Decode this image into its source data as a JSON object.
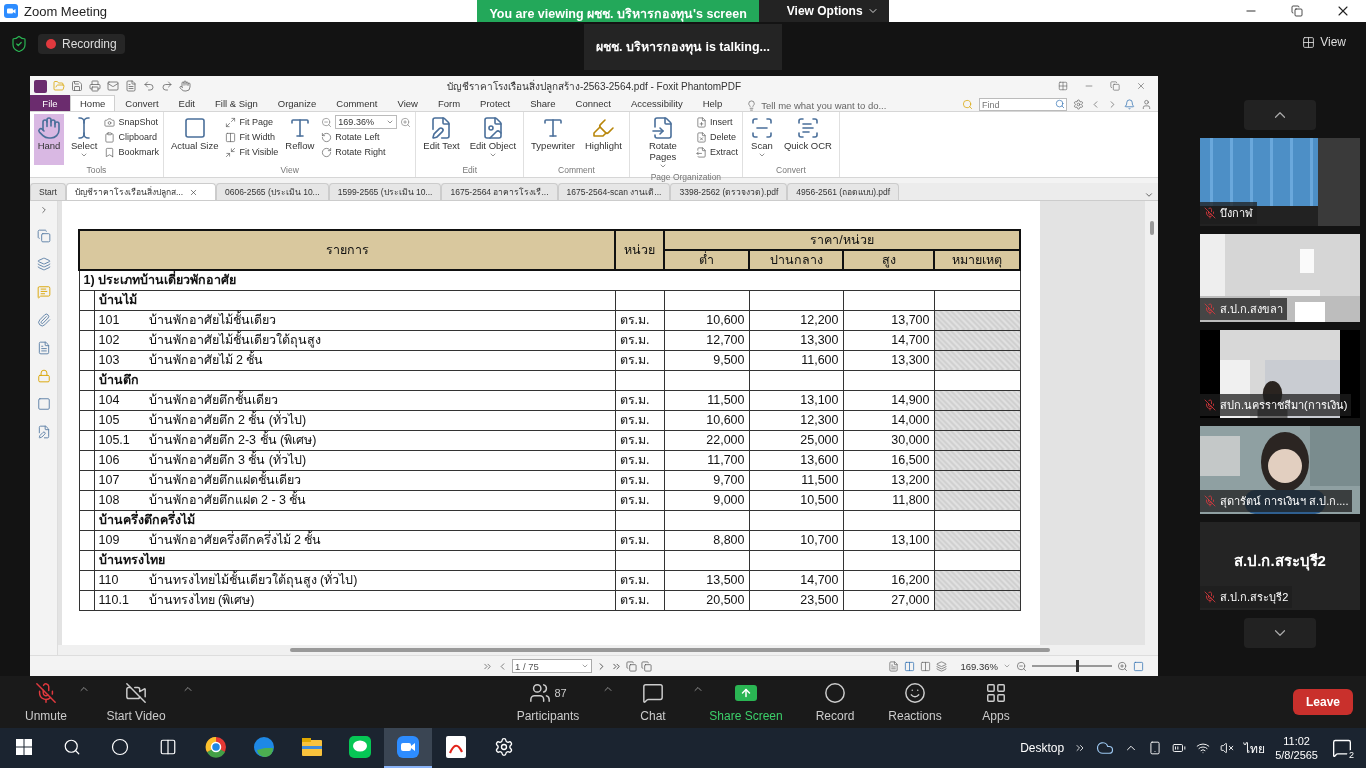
{
  "zoom": {
    "title": "Zoom Meeting",
    "banner": {
      "text": "You are viewing ผชช. บริหารกองทุน's screen",
      "options": "View Options"
    },
    "recording": "Recording",
    "talking": "ผชช. บริหารกองทุน is talking...",
    "view": "View"
  },
  "pdf": {
    "title": "บัญชีราคาโรงเรือนสิ่งปลูกสร้าง-2563-2564.pdf - Foxit PhantomPDF",
    "menu": [
      {
        "label": "File",
        "selected": false
      },
      {
        "label": "Home",
        "selected": true
      },
      {
        "label": "Convert",
        "selected": false
      },
      {
        "label": "Edit",
        "selected": false
      },
      {
        "label": "Fill & Sign",
        "selected": false
      },
      {
        "label": "Organize",
        "selected": false
      },
      {
        "label": "Comment",
        "selected": false
      },
      {
        "label": "View",
        "selected": false
      },
      {
        "label": "Form",
        "selected": false
      },
      {
        "label": "Protect",
        "selected": false
      },
      {
        "label": "Share",
        "selected": false
      },
      {
        "label": "Connect",
        "selected": false
      },
      {
        "label": "Accessibility",
        "selected": false
      },
      {
        "label": "Help",
        "selected": false
      }
    ],
    "tell_me": "Tell me what you want to do...",
    "find": {
      "placeholder": "Find"
    },
    "ribbon": [
      {
        "label": "Tools",
        "items": [
          {
            "kind": "large",
            "label": "Hand",
            "selected": true,
            "dropdown": false
          },
          {
            "kind": "large",
            "label": "Select",
            "selected": false,
            "dropdown": true
          },
          {
            "kind": "stack",
            "entries": [
              "SnapShot",
              "Clipboard",
              "Bookmark"
            ]
          }
        ]
      },
      {
        "label": "View",
        "items": [
          {
            "kind": "large",
            "label": "Actual Size",
            "selected": false,
            "dropdown": false
          },
          {
            "kind": "stack",
            "entries": [
              "Fit Page",
              "Fit Width",
              "Fit Visible"
            ]
          },
          {
            "kind": "large",
            "label": "Reflow",
            "selected": false,
            "dropdown": false
          },
          {
            "kind": "zoom",
            "value": "169.36%",
            "entries": [
              "Rotate Left",
              "Rotate Right"
            ]
          }
        ]
      },
      {
        "label": "Edit",
        "items": [
          {
            "kind": "large",
            "label": "Edit Text",
            "selected": false,
            "dropdown": false
          },
          {
            "kind": "large",
            "label": "Edit Object",
            "selected": false,
            "dropdown": true
          }
        ]
      },
      {
        "label": "Comment",
        "items": [
          {
            "kind": "large",
            "label": "Typewriter",
            "selected": false,
            "dropdown": false
          },
          {
            "kind": "large",
            "label": "Highlight",
            "selected": false,
            "dropdown": false
          }
        ]
      },
      {
        "label": "Page Organization",
        "items": [
          {
            "kind": "large",
            "label": "Rotate Pages",
            "selected": false,
            "dropdown": true
          },
          {
            "kind": "stack",
            "entries": [
              "Insert",
              "Delete",
              "Extract"
            ]
          }
        ]
      },
      {
        "label": "Convert",
        "items": [
          {
            "kind": "large",
            "label": "Scan",
            "selected": false,
            "dropdown": true
          },
          {
            "kind": "large",
            "label": "Quick OCR",
            "selected": false,
            "dropdown": false
          }
        ]
      }
    ],
    "doc_tabs": [
      {
        "label": "Start",
        "selected": false
      },
      {
        "label": "บัญชีราคาโรงเรือนสิ่งปลูกส...",
        "selected": true
      },
      {
        "label": "0606-2565  (ประเมิน 10...",
        "selected": false
      },
      {
        "label": "1599-2565 (ประเมิน 10...",
        "selected": false
      },
      {
        "label": "1675-2564 อาคารโรงเรื...",
        "selected": false
      },
      {
        "label": "1675-2564-scan งานเติ...",
        "selected": false
      },
      {
        "label": "3398-2562 (ตรวจงวด).pdf",
        "selected": false
      },
      {
        "label": "4956-2561 (ถอดแบบ).pdf",
        "selected": false
      }
    ],
    "table": {
      "columns": {
        "item": "รายการ",
        "unit": "หน่วย",
        "price": "ราคา/หน่วย",
        "low": "ต่ำ",
        "mid": "ปานกลาง",
        "high": "สูง",
        "remark": "หมายเหตุ"
      },
      "section": {
        "number": "1)",
        "title": "ประเภทบ้านเดี่ยวพักอาศัย"
      },
      "groups": [
        {
          "title": "บ้านไม้",
          "rows": [
            {
              "code": "101",
              "name": "บ้านพักอาศัยไม้ชั้นเดียว",
              "unit": "ตร.ม.",
              "low": "10,600",
              "mid": "12,200",
              "high": "13,700"
            },
            {
              "code": "102",
              "name": "บ้านพักอาศัยไม้ชั้นเดียวใต้ถุนสูง",
              "unit": "ตร.ม.",
              "low": "12,700",
              "mid": "13,300",
              "high": "14,700"
            },
            {
              "code": "103",
              "name": "บ้านพักอาศัยไม้ 2 ชั้น",
              "unit": "ตร.ม.",
              "low": "9,500",
              "mid": "11,600",
              "high": "13,300"
            }
          ]
        },
        {
          "title": "บ้านตึก",
          "rows": [
            {
              "code": "104",
              "name": "บ้านพักอาศัยตึกชั้นเดียว",
              "unit": "ตร.ม.",
              "low": "11,500",
              "mid": "13,100",
              "high": "14,900"
            },
            {
              "code": "105",
              "name": "บ้านพักอาศัยตึก 2 ชั้น (ทั่วไป)",
              "unit": "ตร.ม.",
              "low": "10,600",
              "mid": "12,300",
              "high": "14,000"
            },
            {
              "code": "105.1",
              "name": "บ้านพักอาศัยตึก 2-3 ชั้น (พิเศษ)",
              "unit": "ตร.ม.",
              "low": "22,000",
              "mid": "25,000",
              "high": "30,000"
            },
            {
              "code": "106",
              "name": "บ้านพักอาศัยตึก 3 ชั้น (ทั่วไป)",
              "unit": "ตร.ม.",
              "low": "11,700",
              "mid": "13,600",
              "high": "16,500"
            },
            {
              "code": "107",
              "name": "บ้านพักอาศัยตึกแฝดชั้นเดียว",
              "unit": "ตร.ม.",
              "low": "9,700",
              "mid": "11,500",
              "high": "13,200"
            },
            {
              "code": "108",
              "name": "บ้านพักอาศัยตึกแฝด 2 - 3 ชั้น",
              "unit": "ตร.ม.",
              "low": "9,000",
              "mid": "10,500",
              "high": "11,800"
            }
          ]
        },
        {
          "title": "บ้านครึ่งตึกครึ่งไม้",
          "rows": [
            {
              "code": "109",
              "name": "บ้านพักอาศัยครึ่งตึกครึ่งไม้ 2 ชั้น",
              "unit": "ตร.ม.",
              "low": "8,800",
              "mid": "10,700",
              "high": "13,100"
            }
          ]
        },
        {
          "title": "บ้านทรงไทย",
          "rows": [
            {
              "code": "110",
              "name": "บ้านทรงไทยไม้ชั้นเดียวใต้ถุนสูง (ทั่วไป)",
              "unit": "ตร.ม.",
              "low": "13,500",
              "mid": "14,700",
              "high": "16,200"
            },
            {
              "code": "110.1",
              "name": "บ้านทรงไทย (พิเศษ)",
              "unit": "ตร.ม.",
              "low": "20,500",
              "mid": "23,500",
              "high": "27,000"
            }
          ]
        }
      ]
    },
    "status": {
      "page": "1 / 75",
      "zoom": "169.36%",
      "zoom_slider": {
        "level": 0.55
      }
    }
  },
  "participants": [
    {
      "kind": "video",
      "name": "บึงกาฬ"
    },
    {
      "kind": "video",
      "name": "ส.ป.ก.สงขลา"
    },
    {
      "kind": "video",
      "name": "สปก.นครราชสีมา(การเงิน)"
    },
    {
      "kind": "video",
      "name": "สุดารัตน์ การเงินฯ ส.ป.ก...."
    },
    {
      "kind": "avatar",
      "display": "ส.ป.ก.สระบุรี2",
      "name": "ส.ป.ก.สระบุรี2"
    }
  ],
  "controls": [
    {
      "kind": "mic",
      "label": "Unmute",
      "menu": true
    },
    {
      "kind": "video",
      "label": "Start Video",
      "menu": true
    },
    {
      "kind": "participants",
      "label": "Participants",
      "count": "87",
      "menu": true
    },
    {
      "kind": "chat",
      "label": "Chat",
      "menu": true
    },
    {
      "kind": "share",
      "label": "Share Screen",
      "menu": false
    },
    {
      "kind": "record",
      "label": "Record",
      "menu": false
    },
    {
      "kind": "reactions",
      "label": "Reactions",
      "menu": false
    },
    {
      "kind": "apps",
      "label": "Apps",
      "menu": false
    }
  ],
  "leave": "Leave",
  "taskbar": {
    "apps": [
      {
        "kind": "chrome",
        "selected": false
      },
      {
        "kind": "edge",
        "selected": false
      },
      {
        "kind": "explorer",
        "selected": false
      },
      {
        "kind": "line",
        "selected": false
      },
      {
        "kind": "zoom",
        "selected": true
      },
      {
        "kind": "acrobat",
        "selected": false
      },
      {
        "kind": "settings",
        "selected": false
      }
    ],
    "desktop": "Desktop",
    "language": "ไทย",
    "time": "11:02",
    "date": "5/8/2565",
    "notifications": "2"
  }
}
